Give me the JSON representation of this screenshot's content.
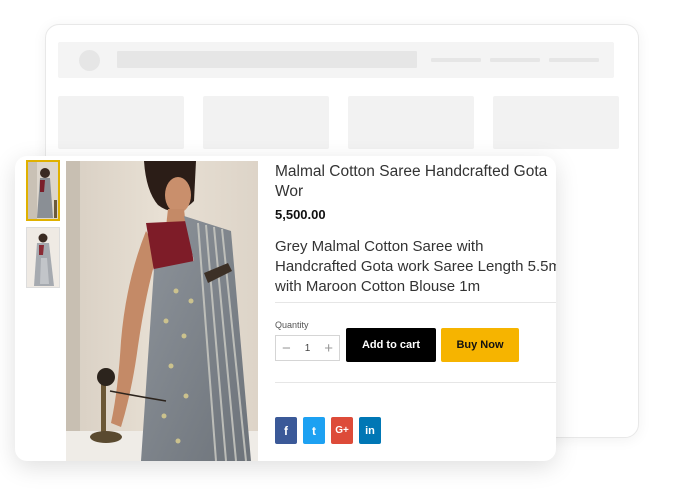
{
  "product": {
    "title": "Malmal Cotton Saree Handcrafted Gota Wor",
    "price": "5,500.00",
    "description": "Grey Malmal Cotton Saree with Handcrafted Gota work Saree Length 5.5m with Maroon Cotton Blouse 1m",
    "quantity_label": "Quantity",
    "quantity_value": "1",
    "minus_symbol": "−",
    "plus_symbol": "+"
  },
  "actions": {
    "add_to_cart": "Add to cart",
    "buy_now": "Buy Now"
  },
  "social": [
    {
      "icon": "facebook-icon",
      "glyph": "f",
      "color": "#3b5998"
    },
    {
      "icon": "twitter-icon",
      "glyph": "t",
      "color": "#1da1f2"
    },
    {
      "icon": "google-plus-icon",
      "glyph": "G+",
      "color": "#dd4b39"
    },
    {
      "icon": "linkedin-icon",
      "glyph": "in",
      "color": "#0077b5"
    }
  ],
  "colors": {
    "accent": "#f6b400",
    "primary_button": "#000000"
  }
}
